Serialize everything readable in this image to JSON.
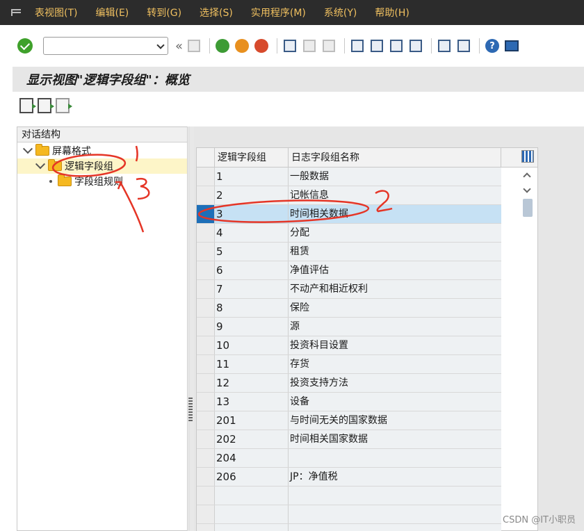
{
  "menu": {
    "items": [
      "表视图(T)",
      "编辑(E)",
      "转到(G)",
      "选择(S)",
      "实用程序(M)",
      "系统(Y)",
      "帮助(H)"
    ]
  },
  "toolbar": {
    "command_value": "",
    "icons": [
      "ok-icon",
      "command-field",
      "back-icon",
      "save-icon",
      "back-green-icon",
      "exit-icon",
      "cancel-icon",
      "print-icon",
      "find-icon",
      "find-next-icon",
      "first-page-icon",
      "prev-page-icon",
      "next-page-icon",
      "last-page-icon",
      "new-session-icon",
      "shortcut-icon",
      "help-icon",
      "customize-icon"
    ]
  },
  "title": "显示视图\"逻辑字段组\"：概览",
  "tree": {
    "header": "对话结构",
    "items": [
      {
        "label": "屏幕格式",
        "level": 0,
        "expanded": true
      },
      {
        "label": "逻辑字段组",
        "level": 1,
        "expanded": true,
        "selected": true
      },
      {
        "label": "字段组规则",
        "level": 2
      }
    ]
  },
  "table": {
    "columns": [
      "逻辑字段组",
      "日志字段组名称"
    ],
    "rows": [
      {
        "id": "1",
        "name": "一般数据"
      },
      {
        "id": "2",
        "name": "记帐信息"
      },
      {
        "id": "3",
        "name": "时间相关数据",
        "selected": true
      },
      {
        "id": "4",
        "name": "分配"
      },
      {
        "id": "5",
        "name": "租赁"
      },
      {
        "id": "6",
        "name": "净值评估"
      },
      {
        "id": "7",
        "name": "不动产和相近权利"
      },
      {
        "id": "8",
        "name": "保险"
      },
      {
        "id": "9",
        "name": "源"
      },
      {
        "id": "10",
        "name": "投资科目设置"
      },
      {
        "id": "11",
        "name": "存货"
      },
      {
        "id": "12",
        "name": "投资支持方法"
      },
      {
        "id": "13",
        "name": "设备"
      },
      {
        "id": "201",
        "name": "与时间无关的国家数据"
      },
      {
        "id": "202",
        "name": "时间相关国家数据"
      },
      {
        "id": "204",
        "name": ""
      },
      {
        "id": "206",
        "name": "JP：净值税"
      }
    ]
  },
  "annotations": {
    "numbers": [
      "1",
      "2",
      "3"
    ],
    "color": "#e53526"
  },
  "watermark": "CSDN @IT小职员",
  "colors": {
    "menubar_bg": "#2c2c2c",
    "menu_text": "#f0c060",
    "selected_row": "#c6e1f4",
    "selected_marker": "#1e6fb8",
    "tree_selected": "#fdf5c8"
  }
}
